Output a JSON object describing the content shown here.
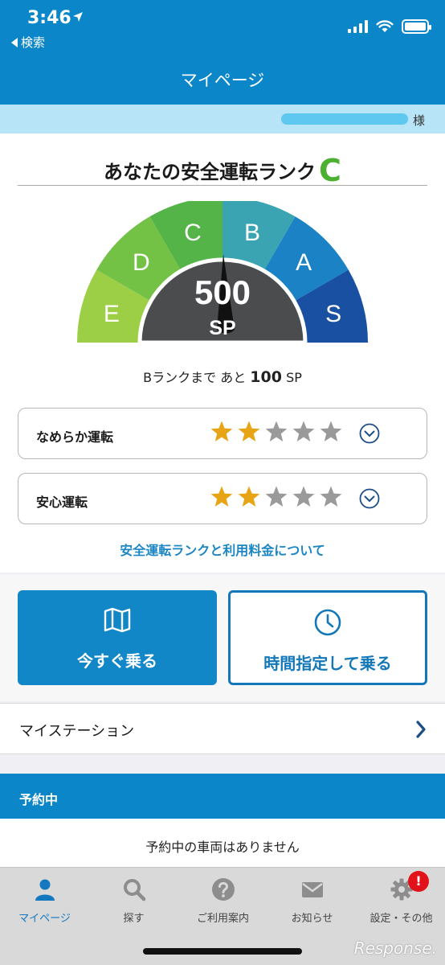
{
  "status_bar": {
    "time": "3:46",
    "back_label": "検索"
  },
  "header": {
    "title": "マイページ"
  },
  "user": {
    "suffix": "様"
  },
  "rank": {
    "title": "あなたの安全運転ランク",
    "current_rank": "C",
    "score": "500",
    "score_unit": "SP",
    "gauge_segments": [
      {
        "label": "E",
        "color": "#9ccf45"
      },
      {
        "label": "D",
        "color": "#73c145"
      },
      {
        "label": "C",
        "color": "#55b447"
      },
      {
        "label": "B",
        "color": "#3ba4b2"
      },
      {
        "label": "A",
        "color": "#1b82c6"
      },
      {
        "label": "S",
        "color": "#1950a1"
      }
    ],
    "next_rank": {
      "prefix": "Bランクまで あと",
      "value": "100",
      "unit": "SP"
    }
  },
  "ratings": [
    {
      "label": "なめらか運転",
      "stars": 2,
      "max_stars": 5
    },
    {
      "label": "安心運転",
      "stars": 2,
      "max_stars": 5
    }
  ],
  "info_link": "安全運転ランクと利用料金について",
  "actions": {
    "ride_now": {
      "label": "今すぐ乗る",
      "icon": "map-icon"
    },
    "ride_timed": {
      "label": "時間指定して乗る",
      "icon": "clock-icon"
    }
  },
  "my_station": {
    "label": "マイステーション"
  },
  "reservation": {
    "title": "予約中",
    "empty_text": "予約中の車両はありません"
  },
  "tabs": [
    {
      "label": "マイページ",
      "icon": "person-icon",
      "active": true
    },
    {
      "label": "探す",
      "icon": "search-icon",
      "active": false
    },
    {
      "label": "ご利用案内",
      "icon": "help-icon",
      "active": false
    },
    {
      "label": "お知らせ",
      "icon": "mail-icon",
      "active": false
    },
    {
      "label": "設定・その他",
      "icon": "gear-icon",
      "active": false,
      "badge": "!"
    }
  ],
  "watermark": "Response.",
  "colors": {
    "brand_blue": "#0a86c9",
    "star_on": "#e8a417",
    "star_off": "#9a9a9a"
  }
}
